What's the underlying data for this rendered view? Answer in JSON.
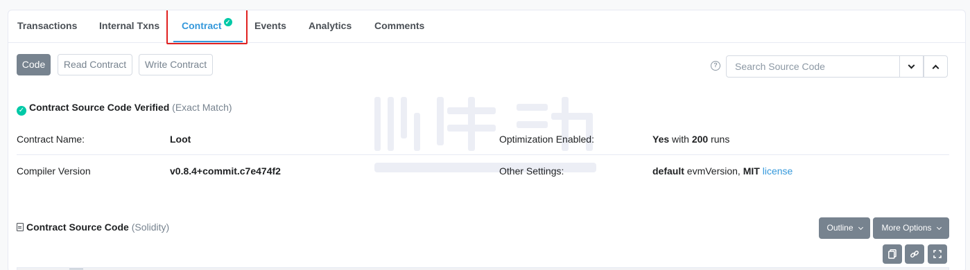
{
  "tabs": [
    {
      "label": "Transactions"
    },
    {
      "label": "Internal Txns"
    },
    {
      "label": "Contract",
      "active": true
    },
    {
      "label": "Events"
    },
    {
      "label": "Analytics"
    },
    {
      "label": "Comments"
    }
  ],
  "toolbar": {
    "code_label": "Code",
    "read_label": "Read Contract",
    "write_label": "Write Contract"
  },
  "search": {
    "placeholder": "Search Source Code"
  },
  "verified": {
    "title": "Contract Source Code Verified",
    "match": "(Exact Match)"
  },
  "details": {
    "name_label": "Contract Name:",
    "name_value": "Loot",
    "compiler_label": "Compiler Version",
    "compiler_value": "v0.8.4+commit.c7e474f2",
    "optimization_label": "Optimization Enabled:",
    "optimization_yes": "Yes",
    "optimization_with": "with",
    "optimization_runs": "200",
    "optimization_runs_label": "runs",
    "other_label": "Other Settings:",
    "other_default": "default",
    "other_evm": "evmVersion,",
    "other_mit": "MIT",
    "other_license": "license"
  },
  "source": {
    "title": "Contract Source Code",
    "lang": "(Solidity)",
    "outline_label": "Outline",
    "more_label": "More Options"
  },
  "icons": [
    "check-circle-icon",
    "question-circle-icon",
    "chevron-down-icon",
    "chevron-up-icon",
    "file-code-icon",
    "copy-icon",
    "link-icon",
    "fullscreen-icon"
  ],
  "colors": {
    "accent": "#3498db",
    "success": "#00c9a7",
    "highlight_border": "#e0201f",
    "button_gray": "#77838f"
  }
}
